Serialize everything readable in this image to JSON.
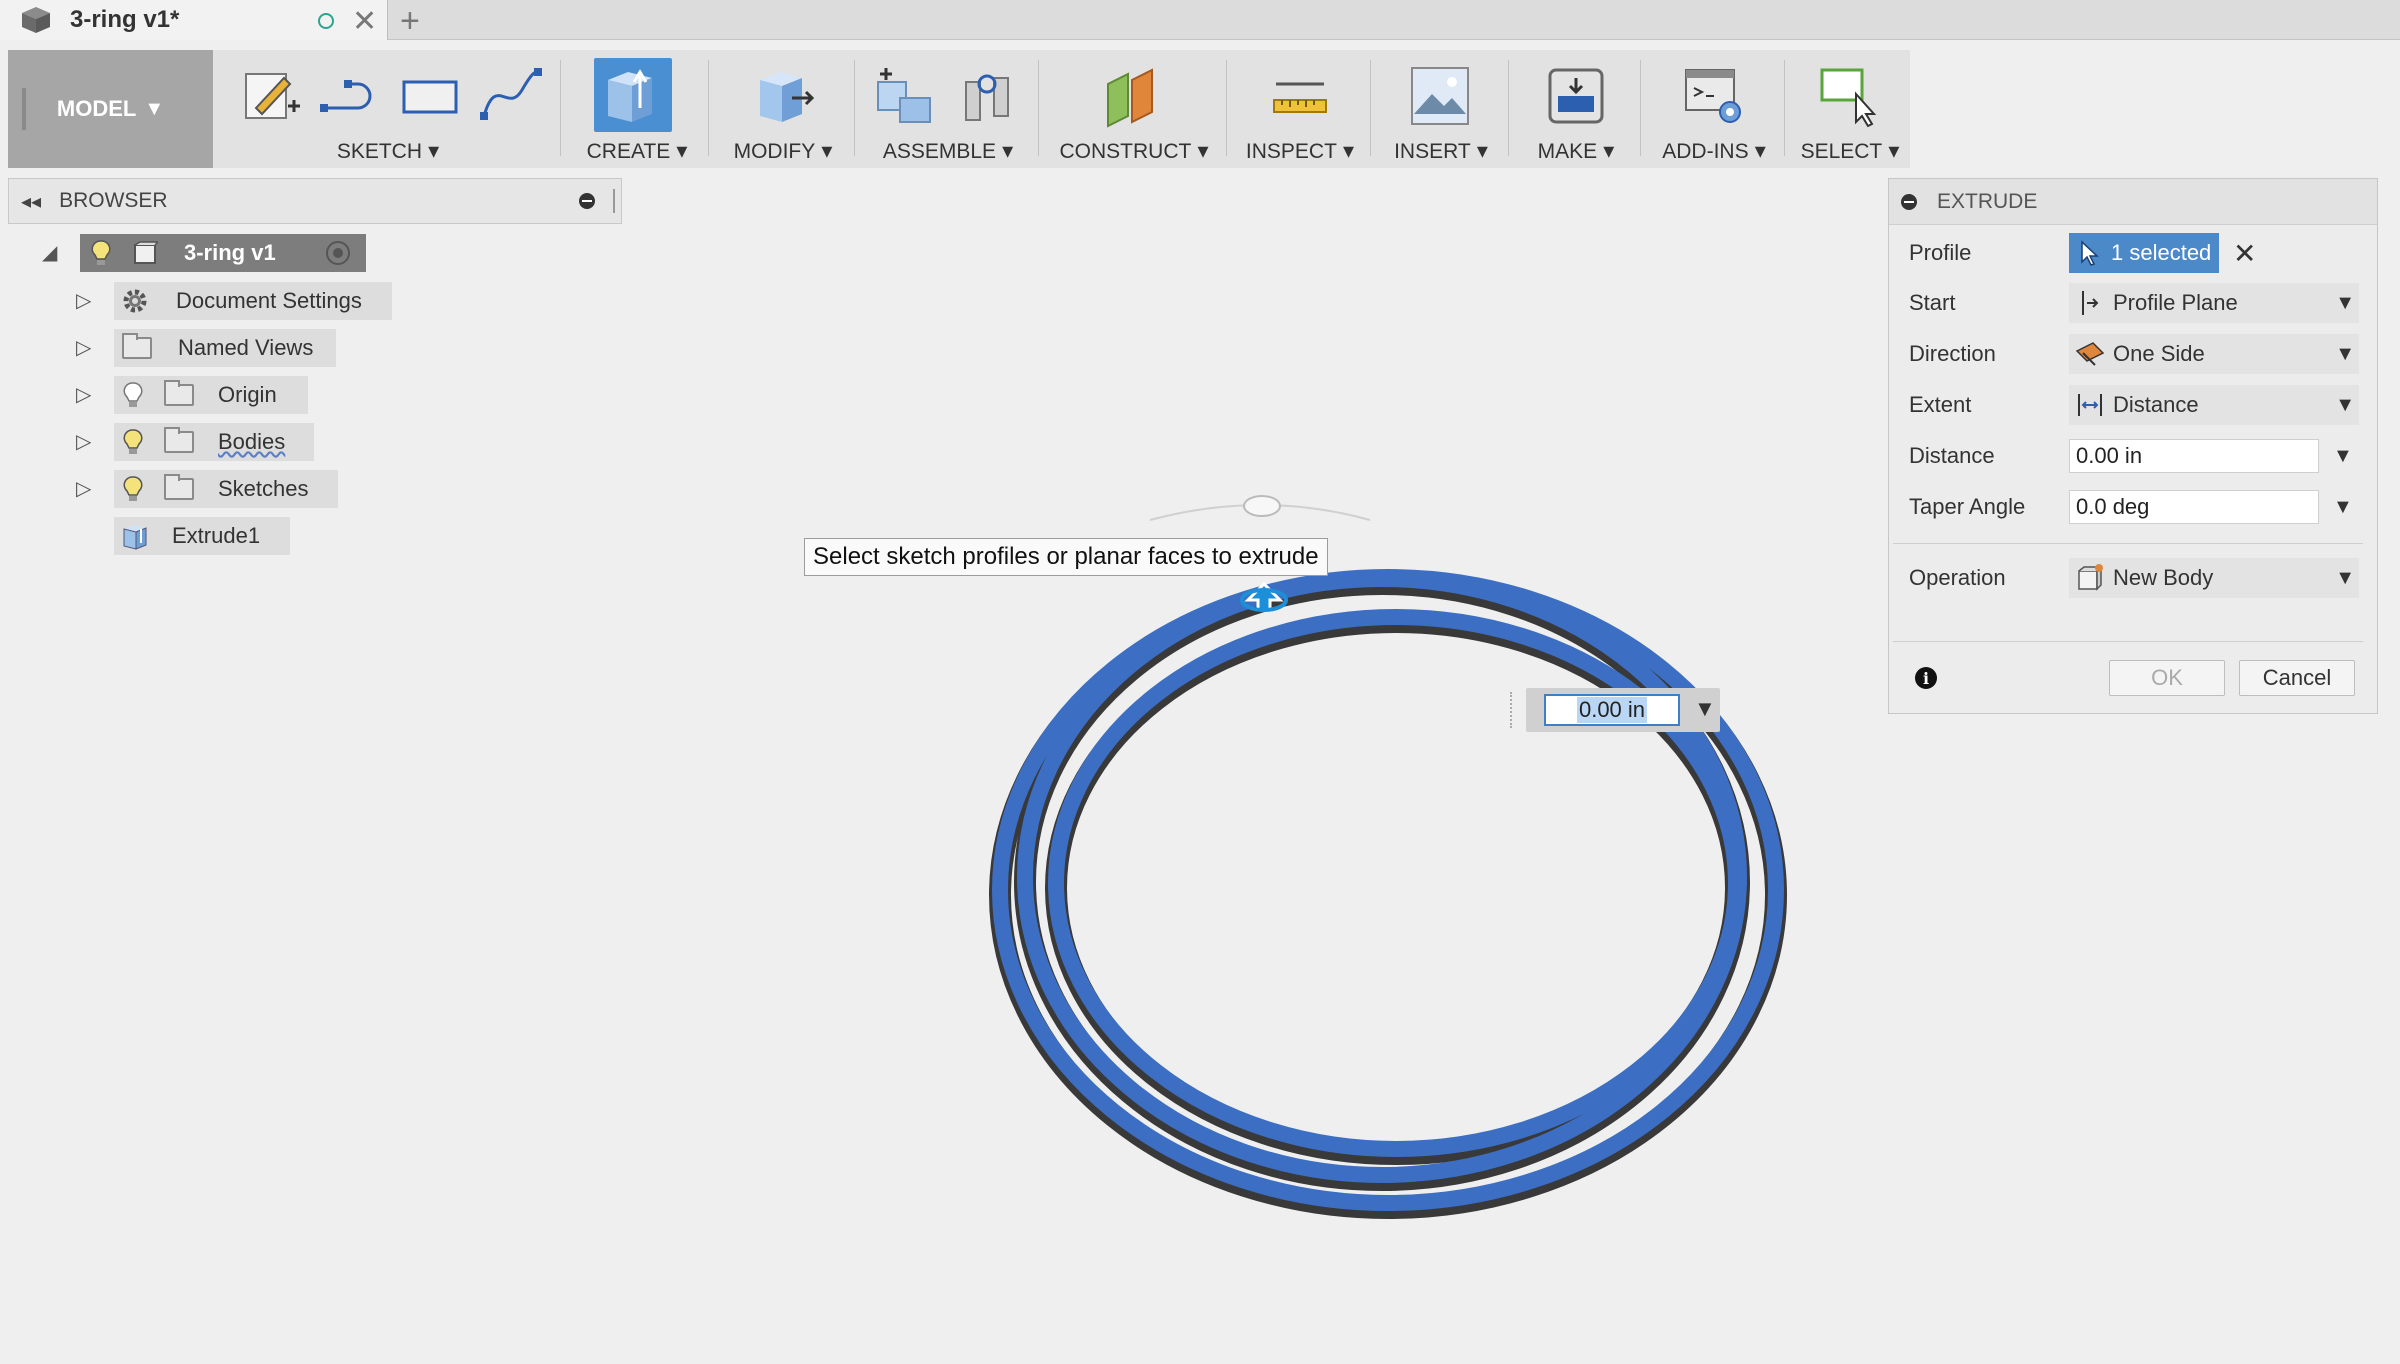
{
  "tab": {
    "title": "3-ring v1*",
    "close": "✕",
    "new_tab": "+"
  },
  "toolbar": {
    "model": "MODEL",
    "groups": {
      "sketch": "SKETCH",
      "create": "CREATE",
      "modify": "MODIFY",
      "assemble": "ASSEMBLE",
      "construct": "CONSTRUCT",
      "inspect": "INSPECT",
      "insert": "INSERT",
      "make": "MAKE",
      "addins": "ADD-INS",
      "select": "SELECT"
    }
  },
  "browser": {
    "title": "BROWSER",
    "collapse": "◂◂",
    "root": "3-ring v1",
    "items": [
      {
        "label": "Document Settings"
      },
      {
        "label": "Named Views"
      },
      {
        "label": "Origin"
      },
      {
        "label": "Bodies"
      },
      {
        "label": "Sketches"
      },
      {
        "label": "Extrude1"
      }
    ]
  },
  "viewport": {
    "tooltip": "Select sketch profiles or planar faces to extrude",
    "distance_input": "0.00 in"
  },
  "extrude": {
    "title": "EXTRUDE",
    "profile_label": "Profile",
    "profile_value": "1 selected",
    "start_label": "Start",
    "start_value": "Profile Plane",
    "direction_label": "Direction",
    "direction_value": "One Side",
    "extent_label": "Extent",
    "extent_value": "Distance",
    "distance_label": "Distance",
    "distance_value": "0.00 in",
    "taper_label": "Taper Angle",
    "taper_value": "0.0 deg",
    "operation_label": "Operation",
    "operation_value": "New Body",
    "ok": "OK",
    "cancel": "Cancel",
    "info": "i"
  },
  "colors": {
    "ring_blue": "#3c6fc4",
    "selection_blue": "#4c89c8",
    "create_highlight": "#4a8fd1"
  }
}
